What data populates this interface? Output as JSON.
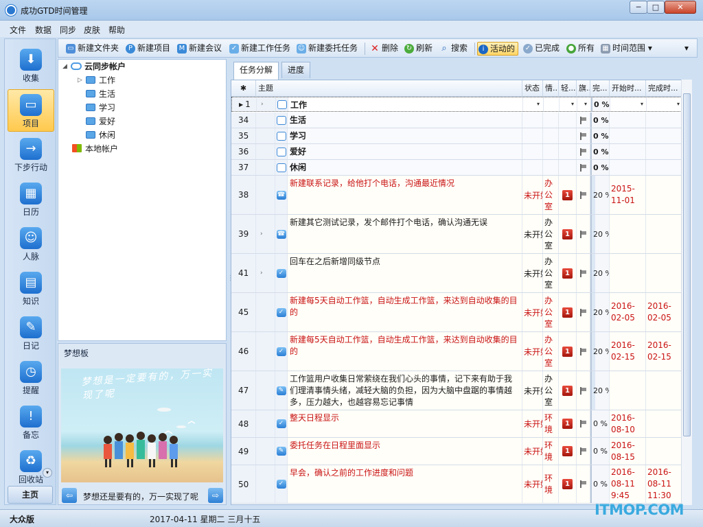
{
  "window": {
    "title": "成功GTD时间管理",
    "min_label": "─",
    "max_label": "□",
    "close_label": "✕"
  },
  "menu": [
    "文件",
    "数据",
    "同步",
    "皮肤",
    "帮助"
  ],
  "nav": {
    "items": [
      {
        "label": "收集",
        "icon": "⬇"
      },
      {
        "label": "项目",
        "icon": "▭"
      },
      {
        "label": "下步行动",
        "icon": "→"
      },
      {
        "label": "日历",
        "icon": "▦"
      },
      {
        "label": "人脉",
        "icon": "☺"
      },
      {
        "label": "知识",
        "icon": "▤"
      },
      {
        "label": "日记",
        "icon": "✎"
      },
      {
        "label": "提醒",
        "icon": "◷"
      },
      {
        "label": "备忘",
        "icon": "!"
      },
      {
        "label": "回收站",
        "icon": "♻"
      }
    ],
    "more_label": "▾",
    "home_label": "主页"
  },
  "toolbar": {
    "new_folder": "新建文件夹",
    "new_project": "新建项目",
    "new_meeting": "新建会议",
    "new_task": "新建工作任务",
    "new_delegated": "新建委托任务",
    "delete": "删除",
    "refresh": "刷新",
    "search": "搜索",
    "active": "活动的",
    "completed": "已完成",
    "all": "所有",
    "time_range": "时间范围",
    "time_range_arrow": "▾",
    "overflow": "▾"
  },
  "tree": {
    "root": "云同步帐户",
    "root_arrow": "◢",
    "children": [
      "工作",
      "生活",
      "学习",
      "爱好",
      "休闲"
    ],
    "child_arrow": "▷",
    "local": "本地帐户"
  },
  "dream": {
    "title": "梦想板",
    "handwriting": "梦想是一定要有的，万一实现了呢",
    "caption": "梦想还是要有的，万一实现了呢",
    "prev": "⇦",
    "next": "⇨"
  },
  "splitter_glyph": "⋮",
  "tabs": [
    "任务分解",
    "进度"
  ],
  "grid": {
    "headers": {
      "star": "✱",
      "subject": "主题",
      "status": "状态",
      "context": "情...",
      "priority": "轻...",
      "flag": "旗...",
      "done": "完...",
      "start": "开始时...",
      "end": "完成时..."
    },
    "filter_row": {
      "num": "1",
      "subject": "工作",
      "dd": "▾",
      "done": "0 %"
    },
    "rows": [
      {
        "num": "34",
        "subject": "生活",
        "bold": true,
        "folder": true,
        "done": "0 %",
        "flag": true
      },
      {
        "num": "35",
        "subject": "学习",
        "bold": true,
        "folder": true,
        "done": "0 %",
        "flag": true
      },
      {
        "num": "36",
        "subject": "爱好",
        "bold": true,
        "folder": true,
        "done": "0 %",
        "flag": true
      },
      {
        "num": "37",
        "subject": "休闲",
        "bold": true,
        "folder": true,
        "done": "0 %",
        "flag": true
      },
      {
        "num": "38",
        "subject": "新建联系记录，给他打个电话，沟通最近情况",
        "red": true,
        "icon": "☎",
        "status": "未开始",
        "context": "办公室",
        "priority": "1",
        "flag": true,
        "done": "20 %",
        "start": "2015-11-01",
        "end": ""
      },
      {
        "num": "39",
        "subject": "新建其它测试记录，发个邮件打个电话，确认沟通无误",
        "red": false,
        "expand": true,
        "icon": "☎",
        "status": "未开始",
        "context": "办公室",
        "priority": "1",
        "flag": true,
        "done": "20 %",
        "start": "",
        "end": ""
      },
      {
        "num": "41",
        "subject": "回车在之后新增同级节点",
        "red": false,
        "expand": true,
        "icon": "✓",
        "status": "未开始",
        "context": "办公室",
        "priority": "1",
        "flag": true,
        "done": "20 %",
        "start": "",
        "end": ""
      },
      {
        "num": "45",
        "subject": "新建每5天自动工作篮，自动生成工作篮，来达到自动收集的目的",
        "red": true,
        "icon": "✓",
        "status": "未开始",
        "context": "办公室",
        "priority": "1",
        "flag": true,
        "done": "20 %",
        "start": "2016-02-05",
        "end": "2016-02-05"
      },
      {
        "num": "46",
        "subject": "新建每5天自动工作篮，自动生成工作篮，来达到自动收集的目的",
        "red": true,
        "icon": "✓",
        "status": "未开始",
        "context": "办公室",
        "priority": "1",
        "flag": true,
        "done": "20 %",
        "start": "2016-02-15",
        "end": "2016-02-15"
      },
      {
        "num": "47",
        "subject": "工作篮用户收集日常萦绕在我们心头的事情，记下来有助于我们理清事情头绪，减轻大脑的负担，因为大脑中盘踞的事情越多，压力越大，也越容易忘记事情",
        "red": false,
        "icon": "✎",
        "status": "未开始",
        "context": "办公室",
        "priority": "1",
        "flag": true,
        "done": "20 %",
        "start": "",
        "end": ""
      },
      {
        "num": "48",
        "subject": "整天日程显示",
        "red": true,
        "icon": "✓",
        "status": "未开始",
        "context": "环境",
        "priority": "1",
        "flag": true,
        "done": "0 %",
        "start": "2016-08-10",
        "end": ""
      },
      {
        "num": "49",
        "subject": "委托任务在日程里面显示",
        "red": true,
        "icon": "✎",
        "status": "未开始",
        "context": "环境",
        "priority": "1",
        "flag": true,
        "done": "0 %",
        "start": "2016-08-15",
        "end": ""
      },
      {
        "num": "50",
        "subject": "早会，确认之前的工作进度和问题",
        "red": true,
        "icon": "✓",
        "status": "未开始",
        "context": "环境",
        "priority": "1",
        "flag": true,
        "done": "0 %",
        "start": "2016-08-11 9:45",
        "end": "2016-08-11 11:30"
      }
    ]
  },
  "statusbar": {
    "edition": "大众版",
    "date": "2017-04-11  星期二  三月十五"
  },
  "watermark": "ITMOP.COM",
  "colors": {
    "accent": "#2b7fd5",
    "active_nav": "#ffc94d",
    "red_text": "#c91313"
  }
}
